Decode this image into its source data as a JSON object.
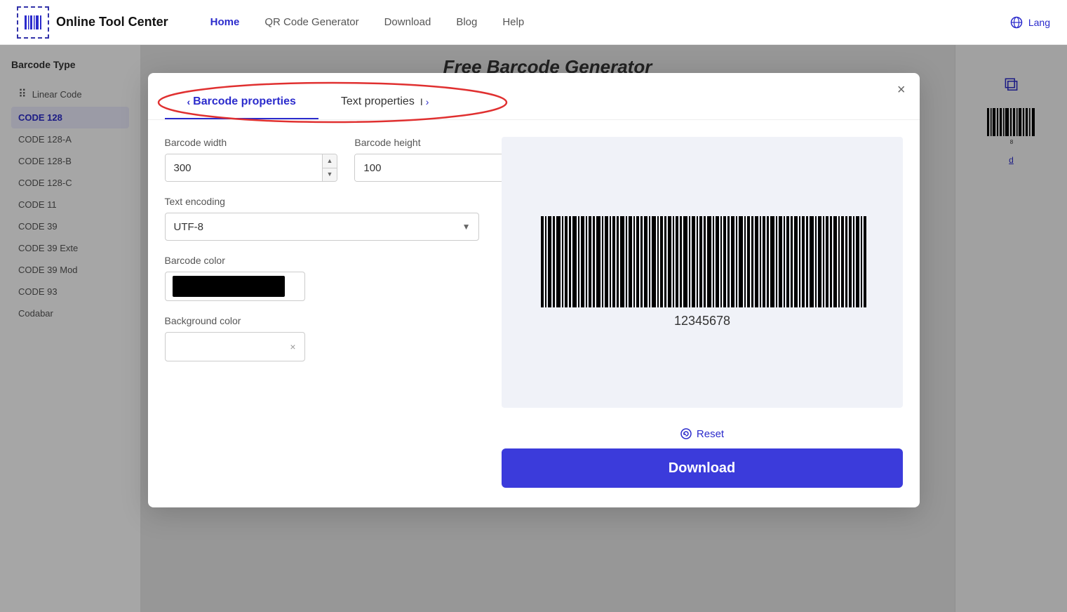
{
  "navbar": {
    "logo_text": "Online Tool Center",
    "links": [
      {
        "label": "Home",
        "active": true
      },
      {
        "label": "QR Code Generator",
        "active": false
      },
      {
        "label": "Download",
        "active": false
      },
      {
        "label": "Blog",
        "active": false
      },
      {
        "label": "Help",
        "active": false
      }
    ],
    "lang_label": "Lang"
  },
  "page_title": "Free Barcode Generator",
  "sidebar": {
    "title": "Barcode Type",
    "items": [
      {
        "label": "Linear Code",
        "active": false,
        "icon": "|||"
      },
      {
        "label": "CODE 128",
        "active": true
      },
      {
        "label": "CODE 128-A",
        "active": false
      },
      {
        "label": "CODE 128-B",
        "active": false
      },
      {
        "label": "CODE 128-C",
        "active": false
      },
      {
        "label": "CODE 11",
        "active": false
      },
      {
        "label": "CODE 39",
        "active": false
      },
      {
        "label": "CODE 39 Exte",
        "active": false
      },
      {
        "label": "CODE 39 Mod",
        "active": false
      },
      {
        "label": "CODE 93",
        "active": false
      },
      {
        "label": "Codabar",
        "active": false
      }
    ]
  },
  "modal": {
    "tabs": [
      {
        "label": "Barcode properties",
        "active": true
      },
      {
        "label": "Text properties",
        "active": false
      }
    ],
    "close_label": "×",
    "barcode_width_label": "Barcode width",
    "barcode_width_value": "300",
    "barcode_height_label": "Barcode height",
    "barcode_height_value": "100",
    "text_encoding_label": "Text encoding",
    "text_encoding_value": "UTF-8",
    "barcode_color_label": "Barcode color",
    "background_color_label": "Background color",
    "reset_label": "Reset",
    "download_label": "Download",
    "barcode_number": "12345678"
  }
}
